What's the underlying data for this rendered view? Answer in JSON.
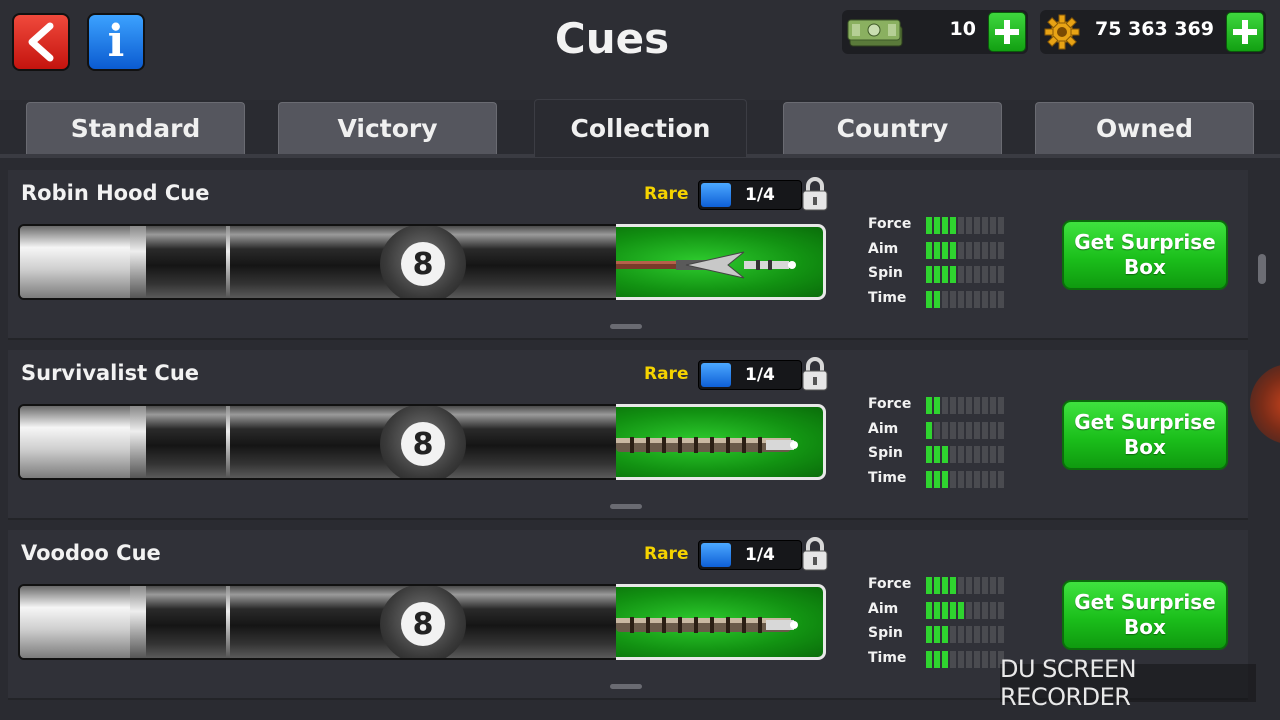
{
  "header": {
    "title": "Cues",
    "cash": "10",
    "coins": "75 363 369"
  },
  "tabs": [
    {
      "label": "Standard",
      "active": false
    },
    {
      "label": "Victory",
      "active": false
    },
    {
      "label": "Collection",
      "active": true
    },
    {
      "label": "Country",
      "active": false
    },
    {
      "label": "Owned",
      "active": false
    }
  ],
  "stat_labels": [
    "Force",
    "Aim",
    "Spin",
    "Time"
  ],
  "stat_segments_total": 10,
  "cues": [
    {
      "name": "Robin Hood Cue",
      "rarity": "Rare",
      "level": "1/4",
      "stats": {
        "Force": 4,
        "Aim": 4,
        "Spin": 4,
        "Time": 2
      },
      "action": "Get Surprise Box",
      "tip_style": "arrow"
    },
    {
      "name": "Survivalist Cue",
      "rarity": "Rare",
      "level": "1/4",
      "stats": {
        "Force": 2,
        "Aim": 1,
        "Spin": 3,
        "Time": 3
      },
      "action": "Get Surprise Box",
      "tip_style": "ornate"
    },
    {
      "name": "Voodoo Cue",
      "rarity": "Rare",
      "level": "1/4",
      "stats": {
        "Force": 4,
        "Aim": 5,
        "Spin": 3,
        "Time": 3
      },
      "action": "Get Surprise Box",
      "tip_style": "ornate"
    }
  ],
  "watermark": "DU SCREEN RECORDER",
  "colors": {
    "background": "#2a2b31",
    "accent_green": "#2fd42f",
    "rarity_yellow": "#f5d300",
    "back_red": "#e0261c",
    "info_blue": "#1f7de8"
  }
}
